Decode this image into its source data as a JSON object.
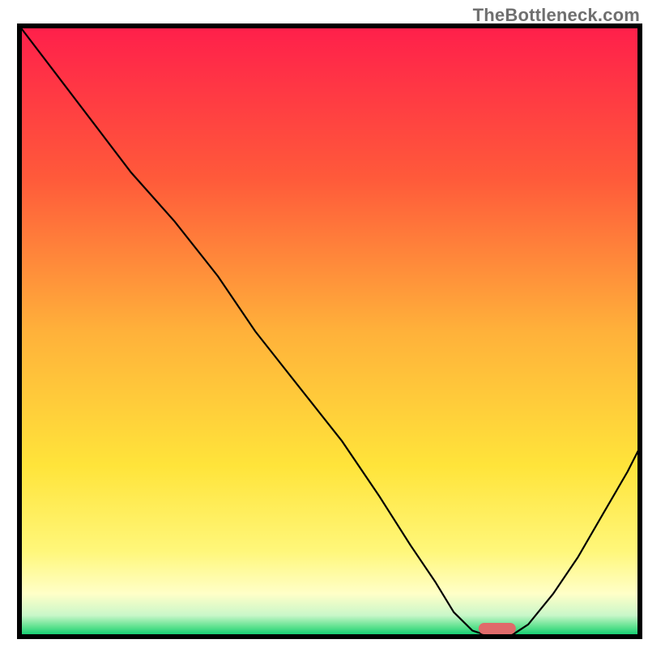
{
  "watermark": "TheBottleneck.com",
  "chart_data": {
    "type": "line",
    "title": "",
    "xlabel": "",
    "ylabel": "",
    "xlim": [
      0,
      100
    ],
    "ylim": [
      0,
      100
    ],
    "grid": false,
    "legend": false,
    "series": [
      {
        "name": "bottleneck-curve",
        "x": [
          0,
          6,
          12,
          18,
          25,
          32,
          38,
          45,
          52,
          58,
          63,
          67,
          70,
          73,
          76,
          79,
          82,
          86,
          90,
          94,
          98,
          100
        ],
        "y": [
          100,
          92,
          84,
          76,
          68,
          59,
          50,
          41,
          32,
          23,
          15,
          9,
          4,
          1,
          0,
          0,
          2,
          7,
          13,
          20,
          27,
          31
        ]
      }
    ],
    "marker": {
      "name": "optimal-range",
      "x_center": 77,
      "width": 6,
      "color": "#e06a6a"
    },
    "gradient_stops": [
      {
        "offset": 0.0,
        "color": "#ff1f4b"
      },
      {
        "offset": 0.25,
        "color": "#ff5a3a"
      },
      {
        "offset": 0.5,
        "color": "#ffb13a"
      },
      {
        "offset": 0.72,
        "color": "#ffe43a"
      },
      {
        "offset": 0.86,
        "color": "#fff77a"
      },
      {
        "offset": 0.93,
        "color": "#ffffc8"
      },
      {
        "offset": 0.965,
        "color": "#c9f7c9"
      },
      {
        "offset": 0.985,
        "color": "#58e08c"
      },
      {
        "offset": 1.0,
        "color": "#00c96b"
      }
    ]
  }
}
